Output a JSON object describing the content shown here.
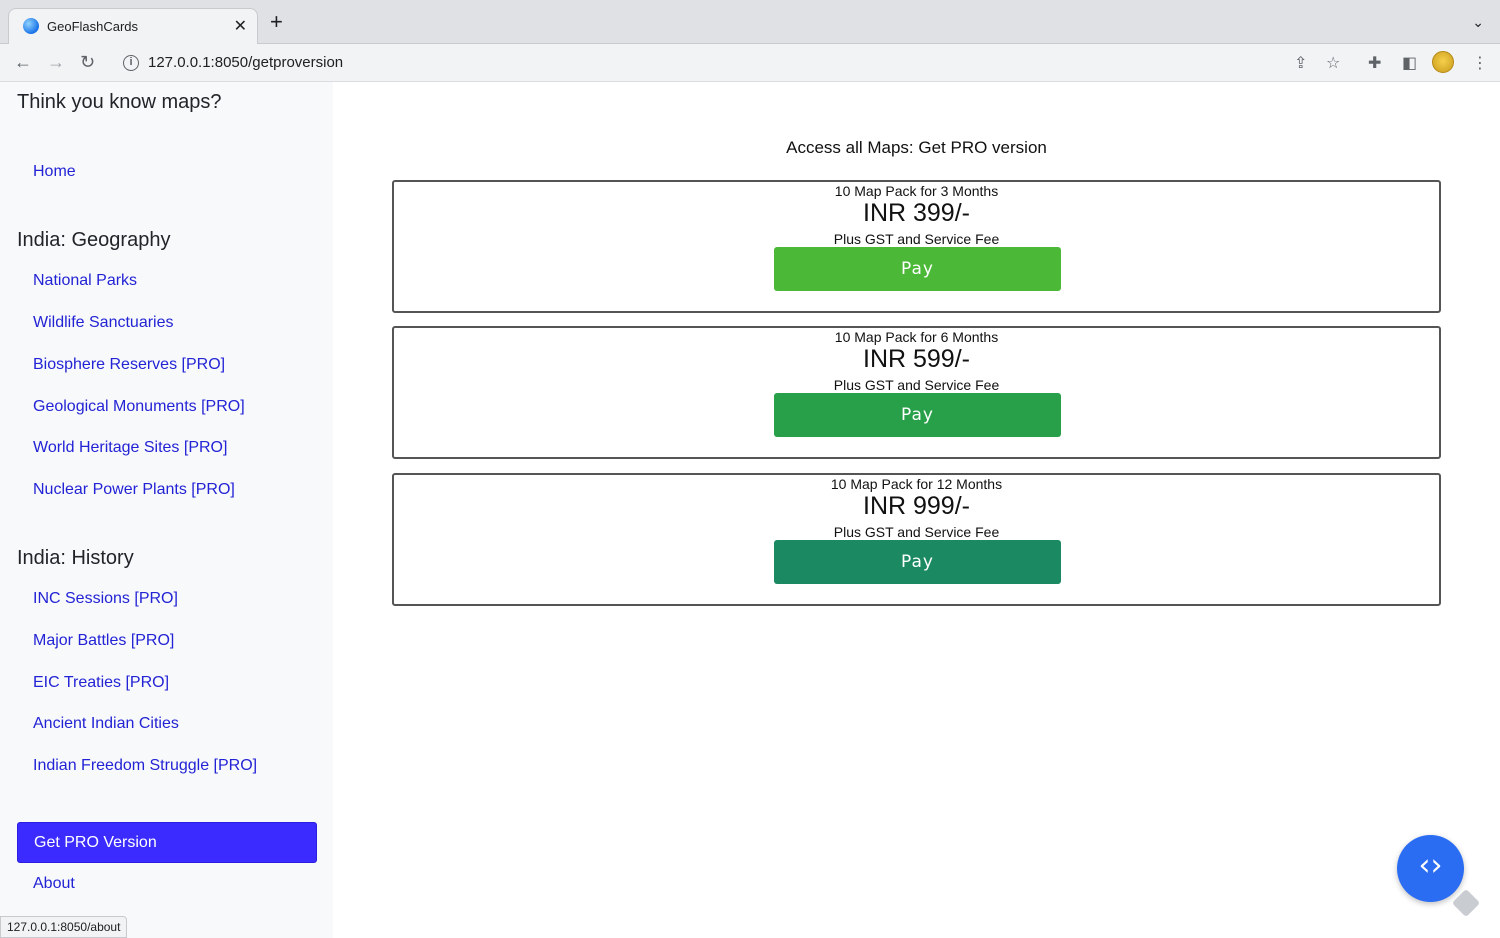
{
  "browser": {
    "tab_title": "GeoFlashCards",
    "tab_close": "✕",
    "new_tab": "+",
    "tabs_menu": "⌄",
    "url": "127.0.0.1:8050/getproversion",
    "status_url": "127.0.0.1:8050/about"
  },
  "sidebar": {
    "brand": "Think you know maps?",
    "home": "Home",
    "sections": [
      {
        "heading": "India: Geography",
        "links": [
          "National Parks",
          "Wildlife Sanctuaries",
          "Biosphere Reserves [PRO]",
          "Geological Monuments [PRO]",
          "World Heritage Sites [PRO]",
          "Nuclear Power Plants [PRO]"
        ]
      },
      {
        "heading": "India: History",
        "links": [
          "INC Sessions [PRO]",
          "Major Battles [PRO]",
          "EIC Treaties [PRO]",
          "Ancient Indian Cities",
          "Indian Freedom Struggle [PRO]"
        ]
      }
    ],
    "pro_button": "Get PRO Version",
    "about": "About"
  },
  "main": {
    "title": "Access all Maps: Get PRO version",
    "plans": [
      {
        "name": "10 Map Pack for 3 Months",
        "price": "INR 399/-",
        "fee": "Plus GST and Service Fee",
        "button": "Pay",
        "color": "#4cb838"
      },
      {
        "name": "10 Map Pack for 6 Months",
        "price": "INR 599/-",
        "fee": "Plus GST and Service Fee",
        "button": "Pay",
        "color": "#28a04a"
      },
      {
        "name": "10 Map Pack for 12 Months",
        "price": "INR 999/-",
        "fee": "Plus GST and Service Fee",
        "button": "Pay",
        "color": "#1b8a63"
      }
    ]
  },
  "colors": {
    "link": "#2323d6",
    "pro_button": "#3b2bff",
    "fab": "#2a6df2"
  },
  "icons": {
    "fab": "code-icon"
  }
}
